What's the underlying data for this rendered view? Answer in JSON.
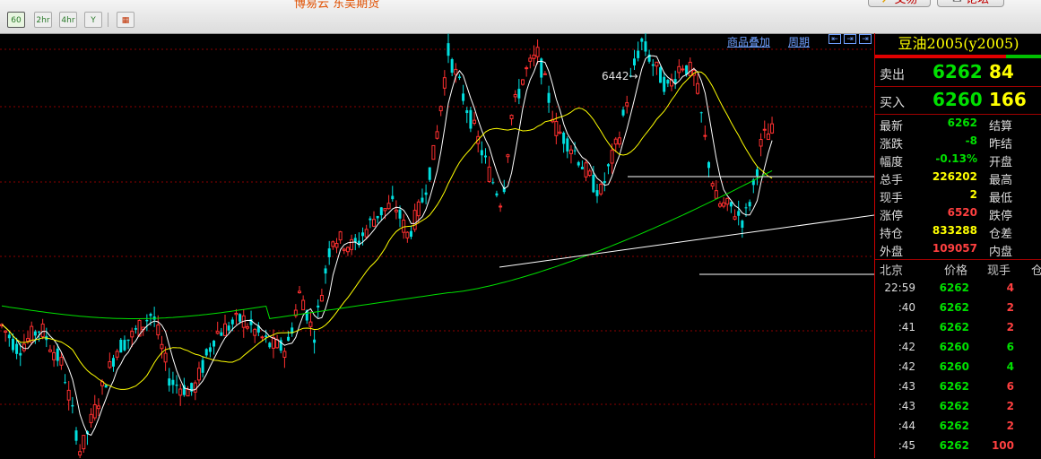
{
  "toolbar": {
    "periods": [
      "60",
      "2hr",
      "4hr",
      "Y"
    ],
    "ticker_fragment": "博易云 东吴期货",
    "trade_button": "交易",
    "forum_button": "论坛"
  },
  "chart_header": {
    "overlay_link": "商品叠加",
    "period_link": "周期"
  },
  "chart_data": {
    "type": "candlestick",
    "annotations": [
      {
        "text": "6442→",
        "value": 6442
      }
    ],
    "colors": {
      "up": "#ff3030",
      "down": "#00e0e0",
      "ma_short": "#ffffff",
      "ma_mid": "#ffff00",
      "ma_long": "#00e000",
      "trendline": "#ffffff",
      "grid": "#8b0000"
    },
    "price_range": [
      4700,
      6620
    ],
    "hlines": [
      6276,
      5480
    ],
    "candle_count": 208
  },
  "panel": {
    "title": "豆油2005(y2005)",
    "ask": {
      "label": "卖出",
      "price": "6262",
      "volume": "84"
    },
    "bid": {
      "label": "买入",
      "price": "6260",
      "volume": "166"
    },
    "stats": [
      {
        "label": "最新",
        "value": "6262",
        "color": "#00e000",
        "label2": "结算"
      },
      {
        "label": "涨跌",
        "value": "-8",
        "color": "#00e000",
        "label2": "昨结"
      },
      {
        "label": "幅度",
        "value": "-0.13%",
        "color": "#00e000",
        "label2": "开盘"
      },
      {
        "label": "总手",
        "value": "226202",
        "color": "#ffff00",
        "label2": "最高"
      },
      {
        "label": "现手",
        "value": "2",
        "color": "#ffff00",
        "label2": "最低"
      },
      {
        "label": "涨停",
        "value": "6520",
        "color": "#ff4040",
        "label2": "跌停"
      },
      {
        "label": "持仓",
        "value": "833288",
        "color": "#ffff00",
        "label2": "仓差"
      },
      {
        "label": "外盘",
        "value": "109057",
        "color": "#ff4040",
        "label2": "内盘"
      }
    ],
    "trades_header": {
      "time": "北京",
      "price": "价格",
      "qty": "现手",
      "extra": "仓"
    },
    "trades": [
      {
        "time": "22:59",
        "price": "6262",
        "qty": "4",
        "qtycolor": "#ff4040"
      },
      {
        "time": ":40",
        "price": "6262",
        "qty": "2",
        "qtycolor": "#ff4040"
      },
      {
        "time": ":41",
        "price": "6262",
        "qty": "2",
        "qtycolor": "#ff4040"
      },
      {
        "time": ":42",
        "price": "6260",
        "qty": "6",
        "qtycolor": "#00e000"
      },
      {
        "time": ":42",
        "price": "6260",
        "qty": "4",
        "qtycolor": "#00e000"
      },
      {
        "time": ":43",
        "price": "6262",
        "qty": "6",
        "qtycolor": "#ff4040"
      },
      {
        "time": ":43",
        "price": "6262",
        "qty": "2",
        "qtycolor": "#ff4040"
      },
      {
        "time": ":44",
        "price": "6262",
        "qty": "2",
        "qtycolor": "#ff4040"
      },
      {
        "time": ":45",
        "price": "6262",
        "qty": "100",
        "qtycolor": "#ff4040"
      }
    ]
  }
}
